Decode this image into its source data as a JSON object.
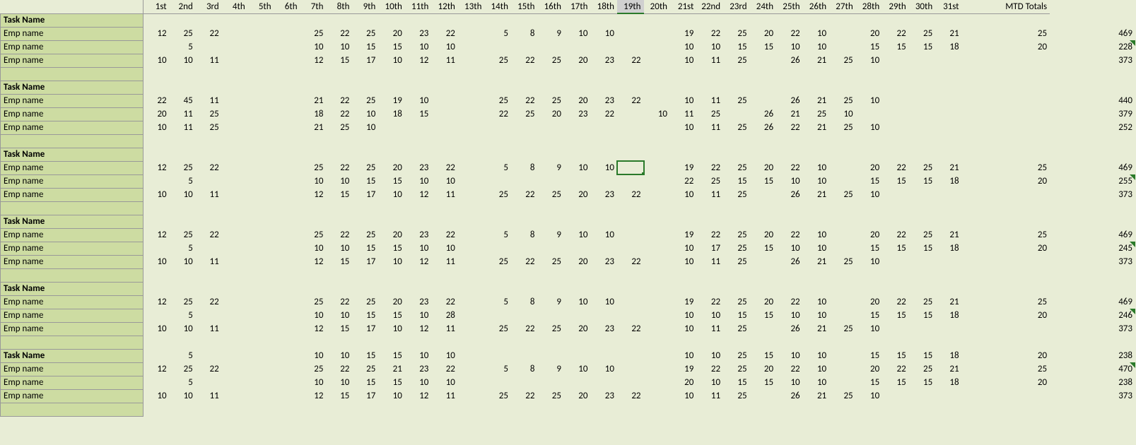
{
  "headers": [
    "1st",
    "2nd",
    "3rd",
    "4th",
    "5th",
    "6th",
    "7th",
    "8th",
    "9th",
    "10th",
    "11th",
    "12th",
    "13th",
    "14th",
    "15th",
    "16th",
    "17th",
    "18th",
    "19th",
    "20th",
    "21st",
    "22nd",
    "23rd",
    "24th",
    "25th",
    "26th",
    "27th",
    "28th",
    "29th",
    "30th",
    "31st"
  ],
  "total_header": "MTD Totals",
  "selected": {
    "row": 12,
    "col": 19
  },
  "task_label": "Task Name",
  "emp_label": "Emp name",
  "groups": [
    {
      "rows": [
        {
          "d": [
            12,
            25,
            22,
            "",
            "",
            "",
            25,
            22,
            25,
            20,
            23,
            22,
            "",
            5,
            8,
            9,
            10,
            10,
            "",
            "",
            19,
            22,
            25,
            20,
            22,
            10,
            "",
            20,
            22,
            25,
            21,
            25
          ],
          "t": 469
        },
        {
          "d": [
            "",
            5,
            "",
            "",
            "",
            "",
            10,
            10,
            15,
            15,
            10,
            10,
            "",
            "",
            "",
            "",
            "",
            "",
            "",
            "",
            10,
            10,
            15,
            15,
            10,
            10,
            "",
            15,
            15,
            15,
            18,
            20
          ],
          "t": 228,
          "err": true
        },
        {
          "d": [
            10,
            10,
            11,
            "",
            "",
            "",
            12,
            15,
            17,
            10,
            12,
            11,
            "",
            25,
            22,
            25,
            20,
            23,
            22,
            "",
            10,
            11,
            25,
            "",
            26,
            21,
            25,
            10,
            "",
            "",
            "",
            ""
          ],
          "t": 373
        }
      ]
    },
    {
      "rows": [
        {
          "d": [
            22,
            45,
            11,
            "",
            "",
            "",
            21,
            22,
            25,
            19,
            10,
            "",
            "",
            25,
            22,
            25,
            20,
            23,
            22,
            "",
            10,
            11,
            25,
            "",
            26,
            21,
            25,
            10,
            "",
            "",
            "",
            ""
          ],
          "t": 440
        },
        {
          "d": [
            20,
            11,
            25,
            "",
            "",
            "",
            18,
            22,
            10,
            18,
            15,
            "",
            "",
            22,
            25,
            20,
            23,
            22,
            "",
            10,
            11,
            25,
            "",
            26,
            21,
            25,
            10,
            "",
            "",
            "",
            "",
            ""
          ],
          "t": 379
        },
        {
          "d": [
            10,
            11,
            25,
            "",
            "",
            "",
            21,
            25,
            10,
            "",
            "",
            "",
            "",
            "",
            "",
            "",
            "",
            "",
            "",
            "",
            10,
            11,
            25,
            26,
            22,
            21,
            25,
            10,
            "",
            "",
            "",
            ""
          ],
          "t": 252
        }
      ]
    },
    {
      "rows": [
        {
          "d": [
            12,
            25,
            22,
            "",
            "",
            "",
            25,
            22,
            25,
            20,
            23,
            22,
            "",
            5,
            8,
            9,
            10,
            10,
            "",
            "",
            19,
            22,
            25,
            20,
            22,
            10,
            "",
            20,
            22,
            25,
            21,
            25
          ],
          "t": 469
        },
        {
          "d": [
            "",
            5,
            "",
            "",
            "",
            "",
            10,
            10,
            15,
            15,
            10,
            10,
            "",
            "",
            "",
            "",
            "",
            "",
            "",
            "",
            22,
            25,
            15,
            15,
            10,
            10,
            "",
            15,
            15,
            15,
            18,
            20
          ],
          "t": 255,
          "err": true
        },
        {
          "d": [
            10,
            10,
            11,
            "",
            "",
            "",
            12,
            15,
            17,
            10,
            12,
            11,
            "",
            25,
            22,
            25,
            20,
            23,
            22,
            "",
            10,
            11,
            25,
            "",
            26,
            21,
            25,
            10,
            "",
            "",
            "",
            ""
          ],
          "t": 373
        }
      ]
    },
    {
      "rows": [
        {
          "d": [
            12,
            25,
            22,
            "",
            "",
            "",
            25,
            22,
            25,
            20,
            23,
            22,
            "",
            5,
            8,
            9,
            10,
            10,
            "",
            "",
            19,
            22,
            25,
            20,
            22,
            10,
            "",
            20,
            22,
            25,
            21,
            25
          ],
          "t": 469
        },
        {
          "d": [
            "",
            5,
            "",
            "",
            "",
            "",
            10,
            10,
            15,
            15,
            10,
            10,
            "",
            "",
            "",
            "",
            "",
            "",
            "",
            "",
            10,
            17,
            25,
            15,
            10,
            10,
            "",
            15,
            15,
            15,
            18,
            20
          ],
          "t": 245,
          "err": true
        },
        {
          "d": [
            10,
            10,
            11,
            "",
            "",
            "",
            12,
            15,
            17,
            10,
            12,
            11,
            "",
            25,
            22,
            25,
            20,
            23,
            22,
            "",
            10,
            11,
            25,
            "",
            26,
            21,
            25,
            10,
            "",
            "",
            "",
            ""
          ],
          "t": 373
        }
      ]
    },
    {
      "rows": [
        {
          "d": [
            12,
            25,
            22,
            "",
            "",
            "",
            25,
            22,
            25,
            20,
            23,
            22,
            "",
            5,
            8,
            9,
            10,
            10,
            "",
            "",
            19,
            22,
            25,
            20,
            22,
            10,
            "",
            20,
            22,
            25,
            21,
            25
          ],
          "t": 469
        },
        {
          "d": [
            "",
            5,
            "",
            "",
            "",
            "",
            10,
            10,
            15,
            15,
            10,
            28,
            "",
            "",
            "",
            "",
            "",
            "",
            "",
            "",
            10,
            10,
            15,
            15,
            10,
            10,
            "",
            15,
            15,
            15,
            18,
            20
          ],
          "t": 246,
          "err": true
        },
        {
          "d": [
            10,
            10,
            11,
            "",
            "",
            "",
            12,
            15,
            17,
            10,
            12,
            11,
            "",
            25,
            22,
            25,
            20,
            23,
            22,
            "",
            10,
            11,
            25,
            "",
            26,
            21,
            25,
            10,
            "",
            "",
            "",
            ""
          ],
          "t": 373
        }
      ]
    },
    {
      "task_row": {
        "d": [
          "",
          5,
          "",
          "",
          "",
          "",
          10,
          10,
          15,
          15,
          10,
          10,
          "",
          "",
          "",
          "",
          "",
          "",
          "",
          "",
          10,
          10,
          25,
          15,
          10,
          10,
          "",
          15,
          15,
          15,
          18,
          20
        ],
        "t": 238
      },
      "rows": [
        {
          "d": [
            12,
            25,
            22,
            "",
            "",
            "",
            25,
            22,
            25,
            21,
            23,
            22,
            "",
            5,
            8,
            9,
            10,
            10,
            "",
            "",
            19,
            22,
            25,
            20,
            22,
            10,
            "",
            20,
            22,
            25,
            21,
            25
          ],
          "t": 470,
          "err": true
        },
        {
          "d": [
            "",
            5,
            "",
            "",
            "",
            "",
            10,
            10,
            15,
            15,
            10,
            10,
            "",
            "",
            "",
            "",
            "",
            "",
            "",
            "",
            20,
            10,
            15,
            15,
            10,
            10,
            "",
            15,
            15,
            15,
            18,
            20
          ],
          "t": 238
        },
        {
          "d": [
            10,
            10,
            11,
            "",
            "",
            "",
            12,
            15,
            17,
            10,
            12,
            11,
            "",
            25,
            22,
            25,
            20,
            23,
            22,
            "",
            10,
            11,
            25,
            "",
            26,
            21,
            25,
            10,
            "",
            "",
            "",
            ""
          ],
          "t": 373
        }
      ]
    }
  ]
}
